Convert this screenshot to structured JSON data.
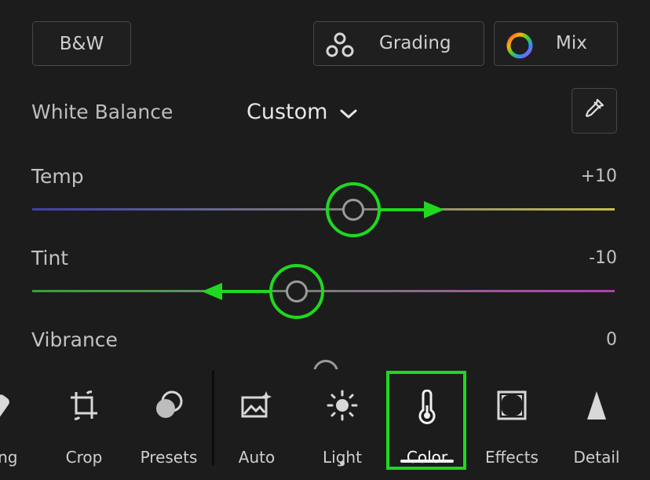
{
  "top_buttons": {
    "bw_label": "B&W",
    "grading_label": "Grading",
    "mix_label": "Mix"
  },
  "white_balance": {
    "label": "White Balance",
    "selected": "Custom"
  },
  "sliders": {
    "temp": {
      "label": "Temp",
      "value": "+10"
    },
    "tint": {
      "label": "Tint",
      "value": "-10"
    },
    "vibrance": {
      "label": "Vibrance",
      "value": "0"
    }
  },
  "toolbar": {
    "items": [
      {
        "label": "ling",
        "icon": "healing-icon"
      },
      {
        "label": "Crop",
        "icon": "crop-icon"
      },
      {
        "label": "Presets",
        "icon": "presets-icon"
      },
      {
        "label": "Auto",
        "icon": "auto-icon"
      },
      {
        "label": "Light",
        "icon": "sun-icon"
      },
      {
        "label": "Color",
        "icon": "thermometer-icon"
      },
      {
        "label": "Effects",
        "icon": "effects-icon"
      },
      {
        "label": "Detail",
        "icon": "detail-icon"
      }
    ],
    "active": "Color"
  },
  "colors": {
    "annotation_green": "#1fd81f",
    "background": "#1c1c1c"
  }
}
